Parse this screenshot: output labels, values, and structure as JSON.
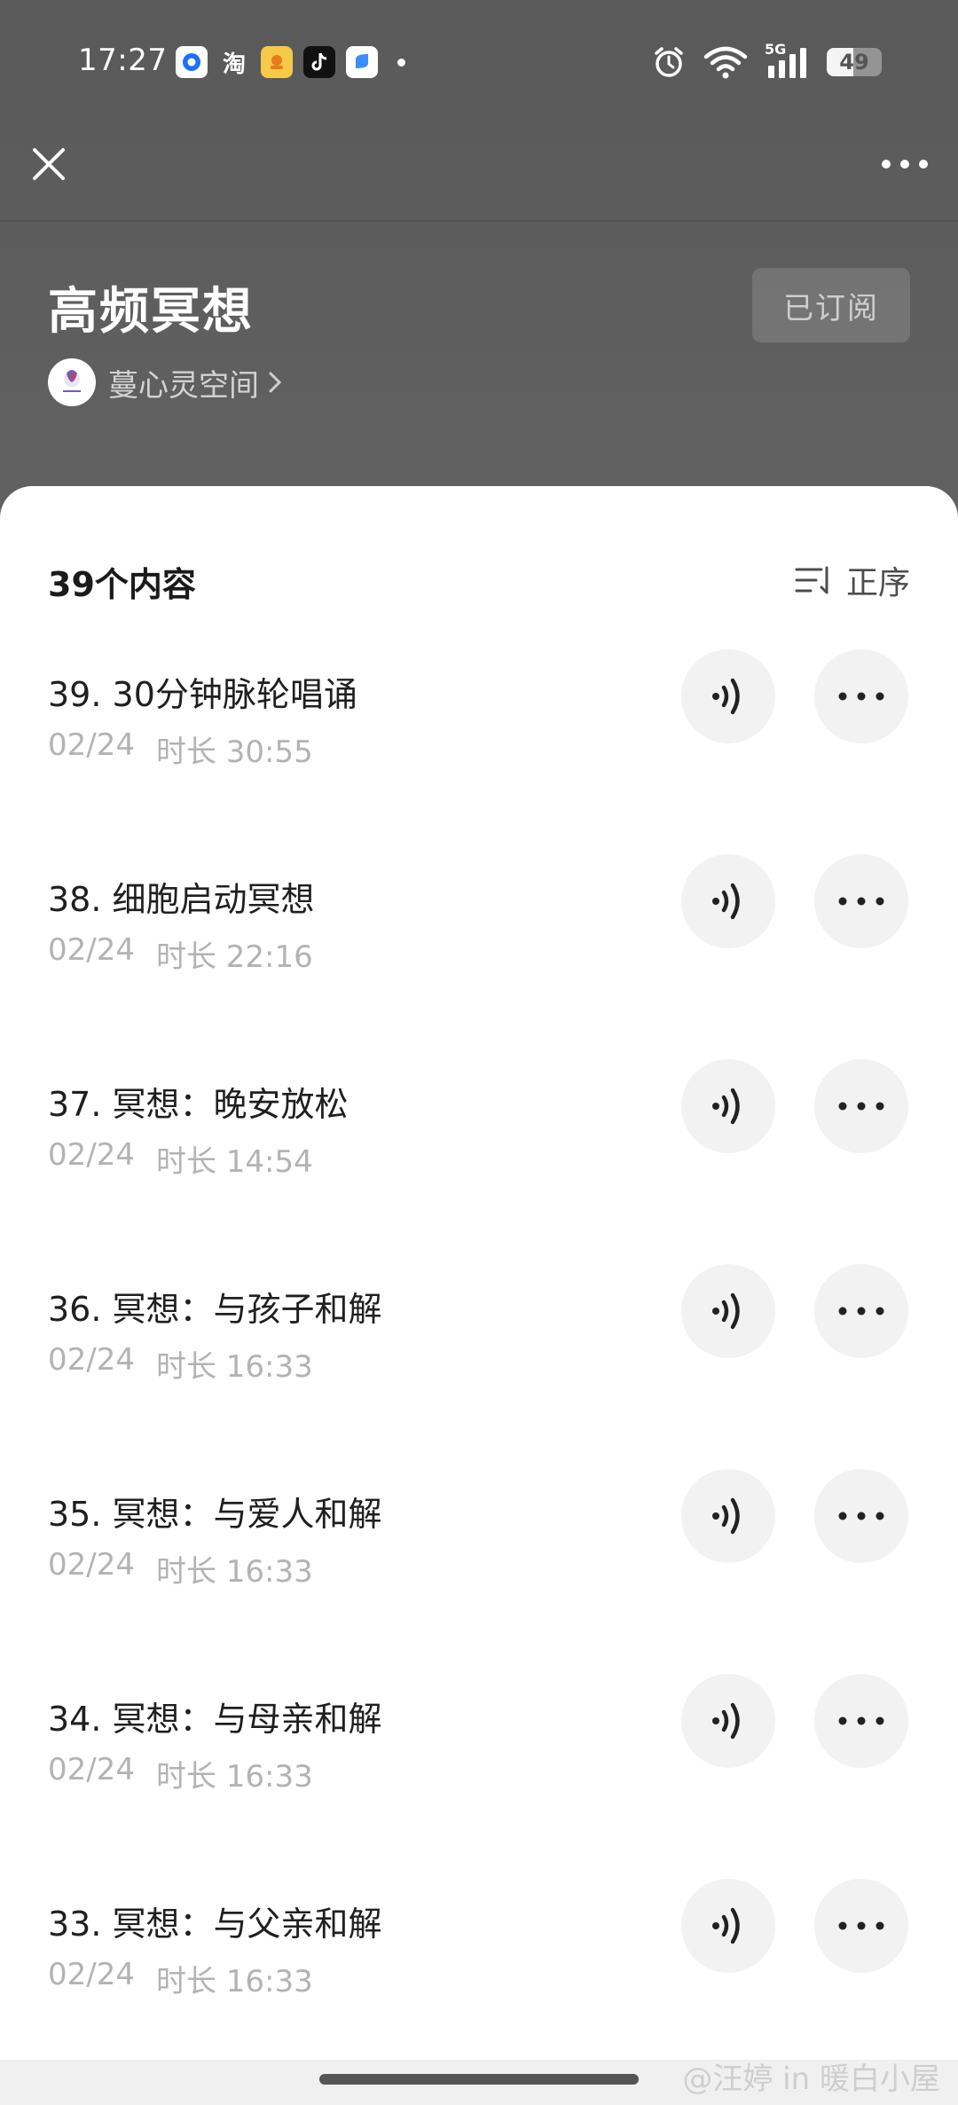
{
  "status_bar": {
    "time": "17:27",
    "apps": [
      "qq-browser",
      "淘",
      "meituan",
      "tiktok",
      "app-blue"
    ],
    "network": "5G",
    "battery": 49
  },
  "nav": {
    "close_icon": "close-icon",
    "more_icon": "more-icon"
  },
  "album": {
    "title": "高频冥想",
    "subscribe_label": "已订阅",
    "author": "蔓心灵空间"
  },
  "list_header": {
    "count_label": "39个内容",
    "sort_label": "正序"
  },
  "episodes": [
    {
      "title": "39. 30分钟脉轮唱诵",
      "date": "02/24",
      "duration": "时长 30:55"
    },
    {
      "title": "38. 细胞启动冥想",
      "date": "02/24",
      "duration": "时长 22:16"
    },
    {
      "title": "37. 冥想：晚安放松",
      "date": "02/24",
      "duration": "时长 14:54"
    },
    {
      "title": "36. 冥想：与孩子和解",
      "date": "02/24",
      "duration": "时长 16:33"
    },
    {
      "title": "35. 冥想：与爱人和解",
      "date": "02/24",
      "duration": "时长 16:33"
    },
    {
      "title": "34. 冥想：与母亲和解",
      "date": "02/24",
      "duration": "时长 16:33"
    },
    {
      "title": "33. 冥想：与父亲和解",
      "date": "02/24",
      "duration": "时长 16:33"
    }
  ],
  "watermark": "@汪婷 in 暖白小屋",
  "colors": {
    "header_bg": "#5c5c5c",
    "card_bg": "#ffffff",
    "button_bg": "#f2f2f2",
    "meta_text": "#b3b3b3"
  }
}
